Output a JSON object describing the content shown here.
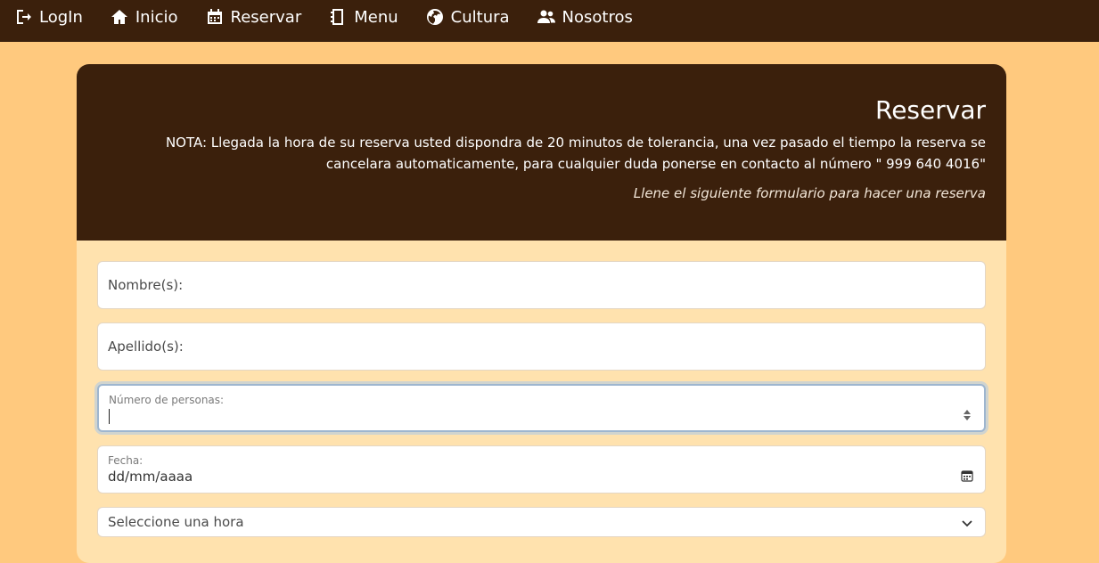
{
  "nav": {
    "items": [
      {
        "label": "LogIn",
        "icon": "login-icon"
      },
      {
        "label": "Inicio",
        "icon": "home-icon"
      },
      {
        "label": "Reservar",
        "icon": "calendar-icon"
      },
      {
        "label": "Menu",
        "icon": "notebook-icon"
      },
      {
        "label": "Cultura",
        "icon": "globe-icon"
      },
      {
        "label": "Nosotros",
        "icon": "users-icon"
      }
    ]
  },
  "header": {
    "title": "Reservar",
    "note": "NOTA: Llegada la hora de su reserva usted dispondra de 20 minutos de tolerancia, una vez pasado el tiempo la reserva se cancelara automaticamente, para cualquier duda ponerse en contacto al número \" 999 640 4016\"",
    "subtitle": "Llene el siguiente formulario para hacer una reserva"
  },
  "form": {
    "nombre_label": "Nombre(s):",
    "apellido_label": "Apellido(s):",
    "personas_label": "Número de personas:",
    "personas_value": "",
    "fecha_label": "Fecha:",
    "fecha_placeholder": "dd/mm/aaaa",
    "hora_selected": "Seleccione una hora"
  }
}
